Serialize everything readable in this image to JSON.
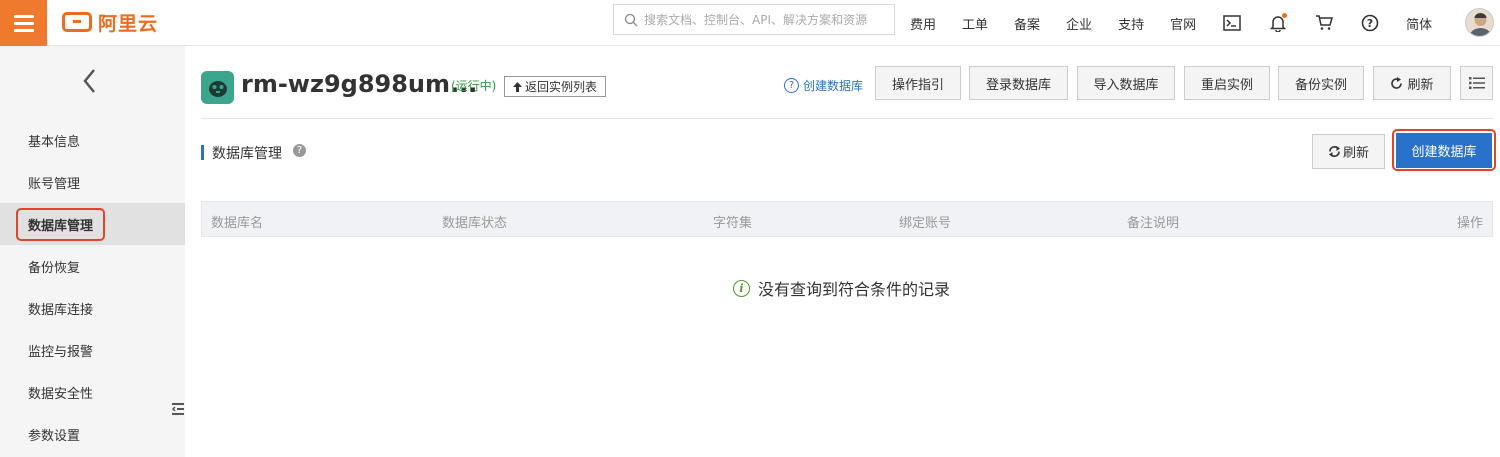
{
  "topbar": {
    "brand": "阿里云",
    "search_placeholder": "搜索文档、控制台、API、解决方案和资源",
    "nav": [
      "费用",
      "工单",
      "备案",
      "企业",
      "支持",
      "官网"
    ],
    "language": "简体"
  },
  "sidebar": {
    "items": [
      {
        "label": "基本信息"
      },
      {
        "label": "账号管理"
      },
      {
        "label": "数据库管理",
        "active": true
      },
      {
        "label": "备份恢复"
      },
      {
        "label": "数据库连接"
      },
      {
        "label": "监控与报警"
      },
      {
        "label": "数据安全性"
      },
      {
        "label": "参数设置"
      }
    ]
  },
  "header": {
    "instance_name": "rm-wz9g898um...",
    "status": "(运行中)",
    "back_to_list": "返回实例列表",
    "help_link": "创建数据库",
    "buttons": {
      "guide": "操作指引",
      "login": "登录数据库",
      "import": "导入数据库",
      "restart": "重启实例",
      "backup": "备份实例",
      "refresh": "刷新"
    }
  },
  "section": {
    "title": "数据库管理",
    "refresh": "刷新",
    "create": "创建数据库"
  },
  "table": {
    "columns": [
      "数据库名",
      "数据库状态",
      "字符集",
      "绑定账号",
      "备注说明",
      "操作"
    ],
    "empty_message": "没有查询到符合条件的记录"
  },
  "colors": {
    "brand_orange": "#ef6b1f",
    "primary_blue": "#2a72c9",
    "highlight_red": "#e0442f",
    "status_green": "#2f9b3f"
  }
}
